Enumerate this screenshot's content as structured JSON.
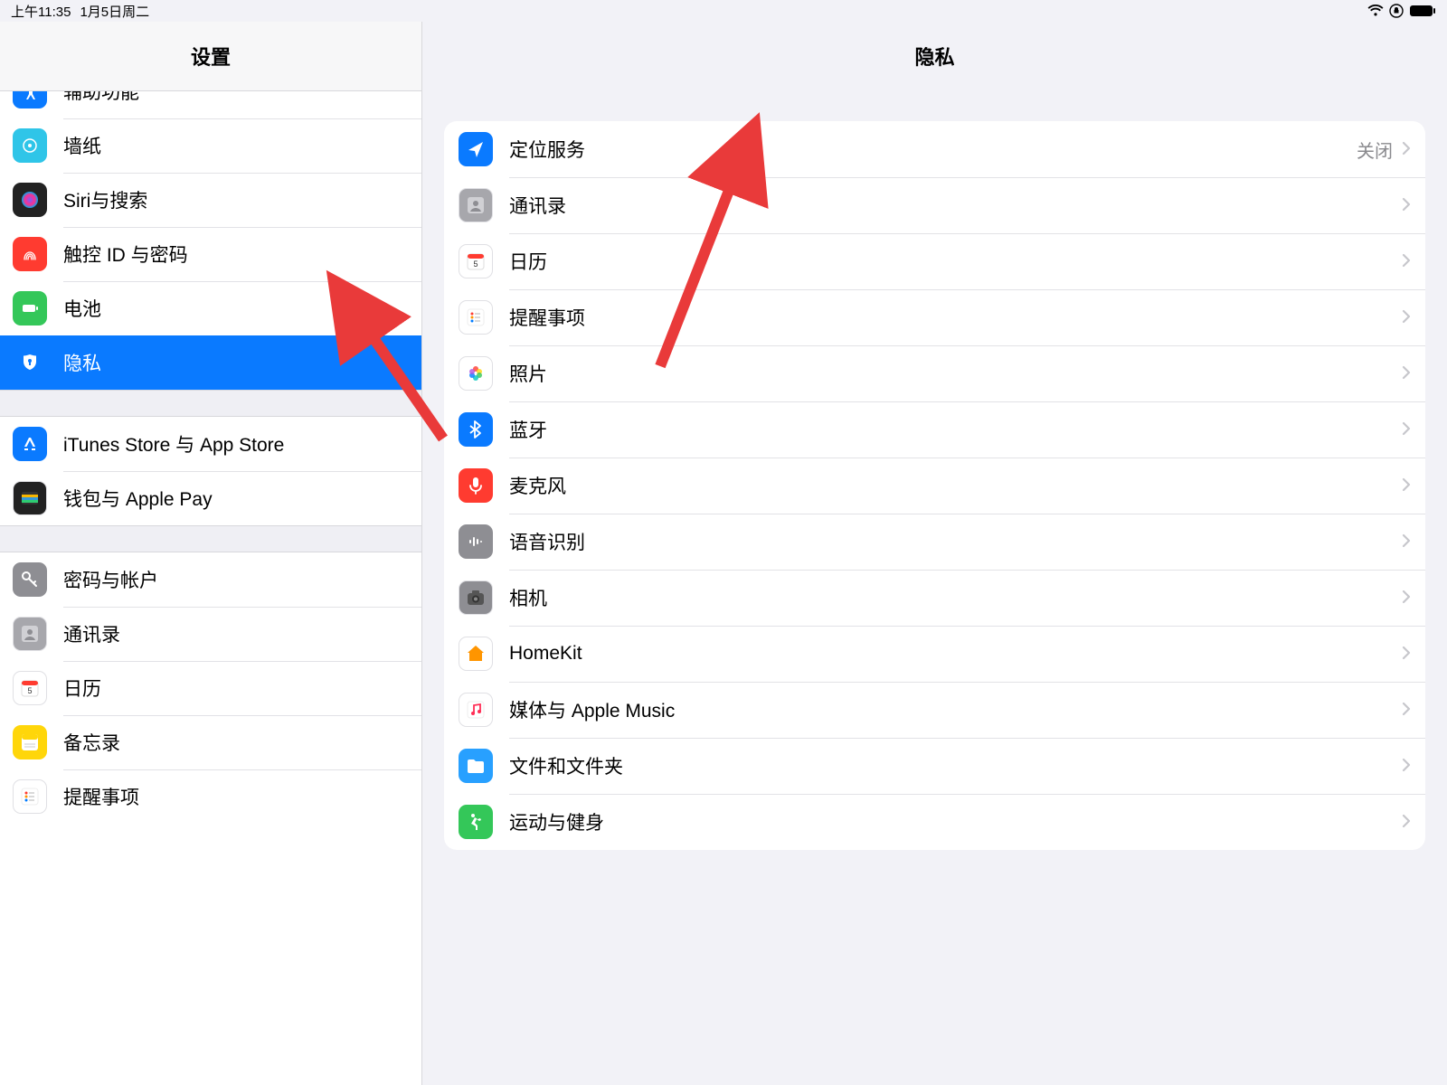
{
  "status": {
    "time": "上午11:35",
    "date": "1月5日周二"
  },
  "sidebar": {
    "title": "设置",
    "groups": [
      {
        "items": [
          {
            "label": "辅助功能",
            "icon": "accessibility",
            "color": "#0a7aff"
          },
          {
            "label": "墙纸",
            "icon": "wallpaper",
            "color": "#2fc5e8"
          },
          {
            "label": "Siri与搜索",
            "icon": "siri",
            "color": "#222"
          },
          {
            "label": "触控 ID 与密码",
            "icon": "touchid",
            "color": "#ff3b30"
          },
          {
            "label": "电池",
            "icon": "battery",
            "color": "#34c759"
          },
          {
            "label": "隐私",
            "icon": "privacy",
            "color": "#0a7aff",
            "selected": true
          }
        ]
      },
      {
        "items": [
          {
            "label": "iTunes Store 与 App Store",
            "icon": "appstore",
            "color": "#0a7aff"
          },
          {
            "label": "钱包与 Apple Pay",
            "icon": "wallet",
            "color": "#222"
          }
        ]
      },
      {
        "items": [
          {
            "label": "密码与帐户",
            "icon": "key",
            "color": "#8e8e93"
          },
          {
            "label": "通讯录",
            "icon": "contacts",
            "color": "#a7a7ac"
          },
          {
            "label": "日历",
            "icon": "calendar",
            "color": "#fff"
          },
          {
            "label": "备忘录",
            "icon": "notes",
            "color": "#ffd60a"
          },
          {
            "label": "提醒事项",
            "icon": "reminders",
            "color": "#fff"
          }
        ]
      }
    ]
  },
  "detail": {
    "title": "隐私",
    "items": [
      {
        "label": "定位服务",
        "icon": "location",
        "color": "#0a7aff",
        "value": "关闭"
      },
      {
        "label": "通讯录",
        "icon": "contacts",
        "color": "#a7a7ac"
      },
      {
        "label": "日历",
        "icon": "calendar",
        "color": "#fff"
      },
      {
        "label": "提醒事项",
        "icon": "reminders",
        "color": "#fff"
      },
      {
        "label": "照片",
        "icon": "photos",
        "color": "#fff"
      },
      {
        "label": "蓝牙",
        "icon": "bluetooth",
        "color": "#0a7aff"
      },
      {
        "label": "麦克风",
        "icon": "microphone",
        "color": "#ff3b30"
      },
      {
        "label": "语音识别",
        "icon": "speech",
        "color": "#8e8e93"
      },
      {
        "label": "相机",
        "icon": "camera",
        "color": "#8e8e93"
      },
      {
        "label": "HomeKit",
        "icon": "homekit",
        "color": "#fff"
      },
      {
        "label": "媒体与 Apple Music",
        "icon": "music",
        "color": "#fff"
      },
      {
        "label": "文件和文件夹",
        "icon": "folder",
        "color": "#28a0ff"
      },
      {
        "label": "运动与健身",
        "icon": "fitness",
        "color": "#34c759"
      }
    ]
  }
}
